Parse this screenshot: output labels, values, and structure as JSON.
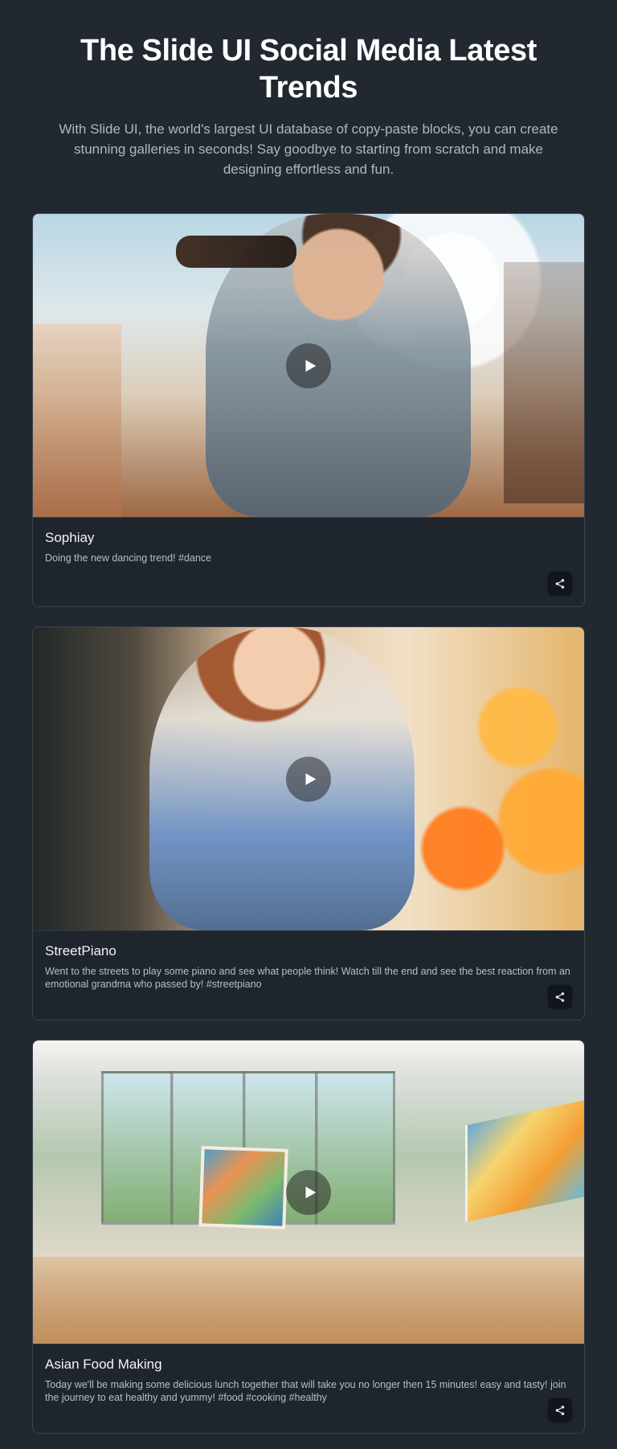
{
  "hero": {
    "title": "The Slide UI Social Media Latest Trends",
    "subtitle": "With Slide UI, the world's largest UI database of copy-paste blocks, you can create stunning galleries in seconds! Say goodbye to starting from scratch and make designing effortless and fun."
  },
  "cards": [
    {
      "title": "Sophiay",
      "text": "Doing the new dancing trend! #dance"
    },
    {
      "title": "StreetPiano",
      "text": "Went to the streets to play some piano and see what people think! Watch till the end and see the best reaction from an emotional grandma who passed by! #streetpiano"
    },
    {
      "title": "Asian Food Making",
      "text": "Today we'll be making some delicious lunch together that will take you no longer then 15 minutes! easy and tasty! join the journey to eat healthy and yummy! #food #cooking #healthy"
    }
  ],
  "icons": {
    "play": "play-icon",
    "share": "share-icon"
  },
  "colors": {
    "page_background": "#212830",
    "card_background": "#1f252c",
    "card_border": "#3b434d",
    "subtitle_text": "#aeb6c1",
    "body_text": "#b7bec8",
    "share_button_background": "#11161c"
  }
}
